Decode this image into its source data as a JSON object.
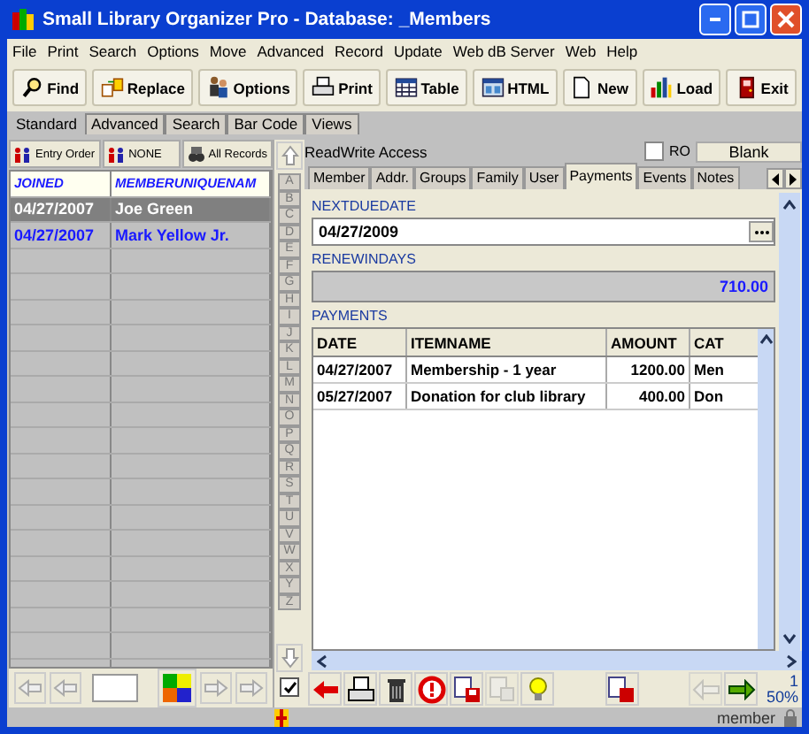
{
  "window": {
    "title": "Small Library Organizer Pro - Database: _Members"
  },
  "menu": [
    "File",
    "Print",
    "Search",
    "Options",
    "Move",
    "Advanced",
    "Record",
    "Update",
    "Web dB Server",
    "Web",
    "Help"
  ],
  "toolbar": [
    "Find",
    "Replace",
    "Options",
    "Print",
    "Table",
    "HTML",
    "New",
    "Load",
    "Exit"
  ],
  "view_tabs": [
    {
      "label": "Standard",
      "selected": true
    },
    {
      "label": "Advanced",
      "selected": false
    },
    {
      "label": "Search",
      "selected": false
    },
    {
      "label": "Bar Code",
      "selected": false
    },
    {
      "label": "Views",
      "selected": false
    }
  ],
  "sort_buttons": [
    "Entry Order",
    "NONE",
    "All Records"
  ],
  "list": {
    "columns": [
      "JOINED",
      "MEMBERUNIQUENAM"
    ],
    "rows": [
      {
        "cells": [
          "04/27/2007",
          "Joe Green"
        ],
        "selected": true
      },
      {
        "cells": [
          "04/27/2007",
          "Mark Yellow Jr."
        ],
        "selected": false
      }
    ]
  },
  "alphabet": [
    "A",
    "B",
    "C",
    "D",
    "E",
    "F",
    "G",
    "H",
    "I",
    "J",
    "K",
    "L",
    "M",
    "N",
    "O",
    "P",
    "Q",
    "R",
    "S",
    "T",
    "U",
    "V",
    "W",
    "X",
    "Y",
    "Z"
  ],
  "record": {
    "access": "ReadWrite Access",
    "ro": {
      "label": "RO",
      "checked": false
    },
    "blank_button": "Blank",
    "tabs": [
      {
        "label": "Member",
        "selected": false
      },
      {
        "label": "Addr.",
        "selected": false
      },
      {
        "label": "Groups",
        "selected": false
      },
      {
        "label": "Family",
        "selected": false
      },
      {
        "label": "User",
        "selected": false
      },
      {
        "label": "Payments",
        "selected": true
      },
      {
        "label": "Events",
        "selected": false
      },
      {
        "label": "Notes",
        "selected": false
      }
    ],
    "fields": [
      {
        "label": "NEXTDUEDATE",
        "value": "04/27/2009",
        "kind": "date"
      },
      {
        "label": "RENEWINDAYS",
        "value": "710.00",
        "kind": "readonly"
      }
    ],
    "payments": {
      "label": "PAYMENTS",
      "columns": [
        "DATE",
        "ITEMNAME",
        "AMOUNT",
        "CAT"
      ],
      "rows": [
        [
          "04/27/2007",
          "Membership - 1 year",
          "1200.00",
          "Men"
        ],
        [
          "05/27/2007",
          "Donation for club library",
          "400.00",
          "Don"
        ]
      ]
    }
  },
  "alpha_checkbox": {
    "checked": true
  },
  "record_count": "1",
  "zoom": "50%",
  "status_bar": {
    "user": "member"
  }
}
